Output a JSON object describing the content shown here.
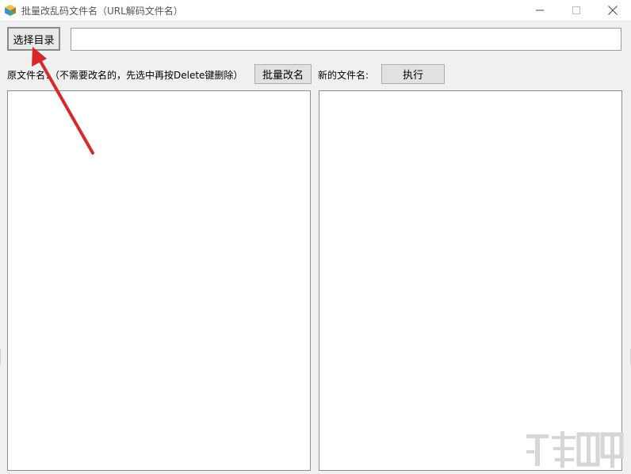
{
  "window": {
    "title": "批量改乱码文件名（URL解码文件名）",
    "icon": "app-cube-icon",
    "controls": [
      "minimize-icon",
      "maximize-icon",
      "close-icon"
    ]
  },
  "toolbar": {
    "select_dir_label": "选择目录",
    "path_value": "",
    "path_placeholder": ""
  },
  "original": {
    "label": "原文件名：（不需要改名的，先选中再按Delete键删除）",
    "rename_label": "批量改名",
    "items": []
  },
  "new_names": {
    "label": "新的文件名:",
    "execute_label": "执行",
    "items": []
  },
  "annotation": {
    "arrow_color": "#d42a2a"
  },
  "colors": {
    "window_bg": "#f0f0f0",
    "button_bg": "#e1e1e1",
    "listbox_bg": "#ffffff"
  }
}
